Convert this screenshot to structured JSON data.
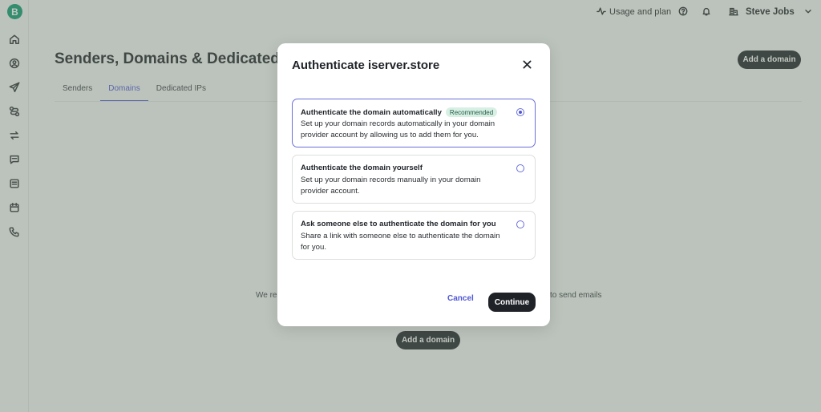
{
  "sidebar": {
    "logo_letter": "B",
    "icons": [
      "home-icon",
      "contacts-icon",
      "campaigns-icon",
      "automations-icon",
      "transactional-icon",
      "conversations-icon",
      "forms-icon",
      "calendar-icon",
      "phone-icon"
    ]
  },
  "topbar": {
    "usage_label": "Usage and plan",
    "account_name": "Steve Jobs"
  },
  "page": {
    "title": "Senders, Domains & Dedicated",
    "add_domain_label": "Add a domain",
    "tabs": [
      {
        "label": "Senders"
      },
      {
        "label": "Domains"
      },
      {
        "label": "Dedicated IPs"
      }
    ],
    "empty_text_start": "We re",
    "empty_text_end": "to send emails",
    "add_domain_bottom_label": "Add a domain"
  },
  "modal": {
    "title": "Authenticate iserver.store",
    "options": [
      {
        "title": "Authenticate the domain automatically",
        "badge": "Recommended",
        "description": "Set up your domain records automatically in your domain provider account by allowing us to add them for you.",
        "selected": true
      },
      {
        "title": "Authenticate the domain yourself",
        "description": "Set up your domain records manually in your domain provider account.",
        "selected": false
      },
      {
        "title": "Ask someone else to authenticate the domain for you",
        "description": "Share a link with someone else to authenticate the domain for you.",
        "selected": false
      }
    ],
    "cancel_label": "Cancel",
    "continue_label": "Continue"
  },
  "colors": {
    "accent": "#4f57d6",
    "brand": "#0b996e",
    "dark_button": "#1f2328",
    "badge_bg": "#d8efe4"
  }
}
